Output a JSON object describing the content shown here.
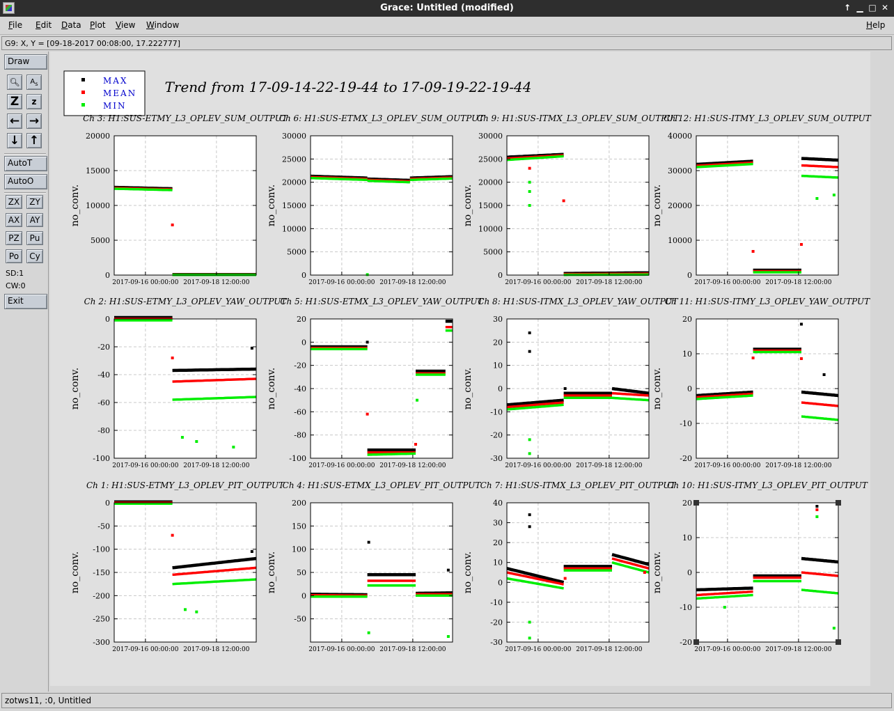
{
  "window": {
    "title": "Grace: Untitled (modified)"
  },
  "menubar": {
    "items": [
      {
        "label": "File",
        "u": "F",
        "rest": "ile"
      },
      {
        "label": "Edit",
        "u": "E",
        "rest": "dit"
      },
      {
        "label": "Data",
        "u": "D",
        "rest": "ata"
      },
      {
        "label": "Plot",
        "u": "P",
        "rest": "lot"
      },
      {
        "label": "View",
        "u": "V",
        "rest": "iew"
      },
      {
        "label": "Window",
        "u": "W",
        "rest": "indow"
      }
    ],
    "help": {
      "label": "Help",
      "u": "H",
      "rest": "elp"
    }
  },
  "locator": "G9: X, Y = [09-18-2017 00:08:00, 17.222777]",
  "toolbar": {
    "draw": "Draw",
    "autoT": "AutoT",
    "autoO": "AutoO",
    "zx": "ZX",
    "zy": "ZY",
    "ax": "AX",
    "ay": "AY",
    "pz": "PZ",
    "pu": "Pu",
    "po": "Po",
    "cy": "Cy",
    "sd": "SD:1",
    "cw": "CW:0",
    "exit": "Exit"
  },
  "status": "zotws11, :0, Untitled",
  "graph_title": "Trend from 17-09-14-22-19-44 to 17-09-19-22-19-44",
  "legend": [
    {
      "label": "MAX",
      "color": "#000000"
    },
    {
      "label": "MEAN",
      "color": "#ff0000"
    },
    {
      "label": "MIN",
      "color": "#00ee00"
    }
  ],
  "colors": {
    "max": "#000000",
    "mean": "#ff0000",
    "min": "#00ee00",
    "legend_text": "#0000cc"
  },
  "chart_data": [
    {
      "type": "scatter",
      "title": "Ch 3: H1:SUS-ETMY_L3_OPLEV_SUM_OUTPUT",
      "ylabel": "no_conv.",
      "xlabel": "",
      "x_ticks": [
        "2017-09-16 00:00:00",
        "2017-09-18 12:00:00"
      ],
      "ylim": [
        0,
        20000
      ],
      "yticks": [
        0,
        5000,
        10000,
        15000,
        20000
      ],
      "segments": [
        {
          "x": [
            0.0,
            0.41
          ],
          "max": [
            12600,
            12400
          ],
          "mean": [
            12500,
            12300
          ],
          "min": [
            12400,
            12200
          ]
        },
        {
          "x": [
            0.41,
            1.0
          ],
          "max": [
            80,
            80
          ],
          "mean": [
            50,
            50
          ],
          "min": [
            20,
            20
          ]
        }
      ],
      "outliers": [
        {
          "x": 0.41,
          "y": 7200,
          "s": "mean"
        }
      ]
    },
    {
      "type": "scatter",
      "title": "Ch 6: H1:SUS-ETMX_L3_OPLEV_SUM_OUTPUT",
      "ylabel": "no_conv.",
      "xlabel": "",
      "x_ticks": [
        "2017-09-16 00:00:00",
        "2017-09-18 12:00:00"
      ],
      "ylim": [
        0,
        30000
      ],
      "yticks": [
        0,
        5000,
        10000,
        15000,
        20000,
        25000,
        30000
      ],
      "segments": [
        {
          "x": [
            0.0,
            0.4
          ],
          "max": [
            21300,
            20900
          ],
          "mean": [
            21100,
            20700
          ],
          "min": [
            20900,
            20500
          ]
        },
        {
          "x": [
            0.4,
            0.7
          ],
          "max": [
            20700,
            20400
          ],
          "mean": [
            20500,
            20200
          ],
          "min": [
            20300,
            20000
          ]
        },
        {
          "x": [
            0.7,
            1.0
          ],
          "max": [
            20900,
            21200
          ],
          "mean": [
            20700,
            21000
          ],
          "min": [
            20500,
            20800
          ]
        }
      ],
      "outliers": [
        {
          "x": 0.4,
          "y": 100,
          "s": "min"
        }
      ]
    },
    {
      "type": "scatter",
      "title": "Ch 9: H1:SUS-ITMX_L3_OPLEV_SUM_OUTPUT",
      "ylabel": "no_conv.",
      "xlabel": "",
      "x_ticks": [
        "2017-09-16 00:00:00",
        "2017-09-18 12:00:00"
      ],
      "ylim": [
        0,
        30000
      ],
      "yticks": [
        0,
        5000,
        10000,
        15000,
        20000,
        25000,
        30000
      ],
      "segments": [
        {
          "x": [
            0.0,
            0.4
          ],
          "max": [
            25400,
            26000
          ],
          "mean": [
            25100,
            25800
          ],
          "min": [
            24800,
            25600
          ]
        },
        {
          "x": [
            0.4,
            1.0
          ],
          "max": [
            350,
            500
          ],
          "mean": [
            200,
            300
          ],
          "min": [
            50,
            100
          ]
        }
      ],
      "outliers": [
        {
          "x": 0.16,
          "y": 15000,
          "s": "min"
        },
        {
          "x": 0.16,
          "y": 20000,
          "s": "min"
        },
        {
          "x": 0.16,
          "y": 18000,
          "s": "min"
        },
        {
          "x": 0.16,
          "y": 23000,
          "s": "mean"
        },
        {
          "x": 0.4,
          "y": 16000,
          "s": "mean"
        }
      ]
    },
    {
      "type": "scatter",
      "title": "Ch 12: H1:SUS-ITMY_L3_OPLEV_SUM_OUTPUT",
      "ylabel": "no_conv.",
      "xlabel": "",
      "x_ticks": [
        "2017-09-16 00:00:00",
        "2017-09-18 12:00:00"
      ],
      "ylim": [
        0,
        40000
      ],
      "yticks": [
        0,
        10000,
        20000,
        30000,
        40000
      ],
      "segments": [
        {
          "x": [
            0.0,
            0.4
          ],
          "max": [
            31800,
            32700
          ],
          "mean": [
            31400,
            32300
          ],
          "min": [
            31000,
            31900
          ]
        },
        {
          "x": [
            0.4,
            0.74
          ],
          "max": [
            1400,
            1400
          ],
          "mean": [
            1100,
            1100
          ],
          "min": [
            800,
            800
          ]
        },
        {
          "x": [
            0.74,
            1.0
          ],
          "max": [
            33500,
            33000
          ],
          "mean": [
            31500,
            31000
          ],
          "min": [
            28500,
            28000
          ]
        }
      ],
      "outliers": [
        {
          "x": 0.4,
          "y": 6800,
          "s": "mean"
        },
        {
          "x": 0.74,
          "y": 8800,
          "s": "mean"
        },
        {
          "x": 0.85,
          "y": 22000,
          "s": "min"
        },
        {
          "x": 0.97,
          "y": 23000,
          "s": "min"
        }
      ]
    },
    {
      "type": "scatter",
      "title": "Ch 2: H1:SUS-ETMY_L3_OPLEV_YAW_OUTPUT",
      "ylabel": "no_conv.",
      "xlabel": "",
      "x_ticks": [
        "2017-09-16 00:00:00",
        "2017-09-18 12:00:00"
      ],
      "ylim": [
        -100,
        0
      ],
      "yticks": [
        -100,
        -80,
        -60,
        -40,
        -20,
        0
      ],
      "segments": [
        {
          "x": [
            0.0,
            0.41
          ],
          "max": [
            1,
            1
          ],
          "mean": [
            0,
            0
          ],
          "min": [
            -1,
            -1
          ]
        },
        {
          "x": [
            0.41,
            1.0
          ],
          "max": [
            -37,
            -36
          ],
          "mean": [
            -45,
            -43
          ],
          "min": [
            -58,
            -56
          ]
        }
      ],
      "outliers": [
        {
          "x": 0.41,
          "y": -28,
          "s": "mean"
        },
        {
          "x": 0.48,
          "y": -85,
          "s": "min"
        },
        {
          "x": 0.58,
          "y": -88,
          "s": "min"
        },
        {
          "x": 0.84,
          "y": -92,
          "s": "min"
        },
        {
          "x": 0.97,
          "y": -21,
          "s": "max"
        }
      ]
    },
    {
      "type": "scatter",
      "title": "Ch 5: H1:SUS-ETMX_L3_OPLEV_YAW_OUTPUT",
      "ylabel": "no_conv.",
      "xlabel": "",
      "x_ticks": [
        "2017-09-16 00:00:00",
        "2017-09-18 12:00:00"
      ],
      "ylim": [
        -100,
        20
      ],
      "yticks": [
        -100,
        -80,
        -60,
        -40,
        -20,
        0,
        20
      ],
      "segments": [
        {
          "x": [
            0.0,
            0.4
          ],
          "max": [
            -4,
            -4
          ],
          "mean": [
            -5,
            -5
          ],
          "min": [
            -6,
            -6
          ]
        },
        {
          "x": [
            0.4,
            0.74
          ],
          "max": [
            -93,
            -93
          ],
          "mean": [
            -95,
            -95
          ],
          "min": [
            -97,
            -96
          ]
        },
        {
          "x": [
            0.74,
            0.95
          ],
          "max": [
            -25,
            -25
          ],
          "mean": [
            -27,
            -27
          ],
          "min": [
            -28,
            -28
          ]
        },
        {
          "x": [
            0.95,
            1.0
          ],
          "max": [
            18,
            18
          ],
          "mean": [
            13,
            13
          ],
          "min": [
            10,
            10
          ]
        }
      ],
      "outliers": [
        {
          "x": 0.4,
          "y": 0,
          "s": "max"
        },
        {
          "x": 0.4,
          "y": -62,
          "s": "mean"
        },
        {
          "x": 0.74,
          "y": -88,
          "s": "mean"
        },
        {
          "x": 0.75,
          "y": -50,
          "s": "min"
        }
      ]
    },
    {
      "type": "scatter",
      "title": "Ch 8: H1:SUS-ITMX_L3_OPLEV_YAW_OUTPUT",
      "ylabel": "no_conv.",
      "xlabel": "",
      "x_ticks": [
        "2017-09-16 00:00:00",
        "2017-09-18 12:00:00"
      ],
      "ylim": [
        -30,
        30
      ],
      "yticks": [
        -30,
        -20,
        -10,
        0,
        10,
        20,
        30
      ],
      "segments": [
        {
          "x": [
            0.0,
            0.4
          ],
          "max": [
            -7,
            -5
          ],
          "mean": [
            -8,
            -6
          ],
          "min": [
            -9,
            -7
          ]
        },
        {
          "x": [
            0.4,
            0.74
          ],
          "max": [
            -2,
            -2
          ],
          "mean": [
            -3,
            -3
          ],
          "min": [
            -4,
            -4
          ]
        },
        {
          "x": [
            0.74,
            1.0
          ],
          "max": [
            0,
            -2
          ],
          "mean": [
            -2,
            -3
          ],
          "min": [
            -4,
            -5
          ]
        }
      ],
      "outliers": [
        {
          "x": 0.16,
          "y": 24,
          "s": "max"
        },
        {
          "x": 0.16,
          "y": 16,
          "s": "max"
        },
        {
          "x": 0.16,
          "y": -28,
          "s": "min"
        },
        {
          "x": 0.16,
          "y": -22,
          "s": "min"
        },
        {
          "x": 0.41,
          "y": 0,
          "s": "max"
        }
      ]
    },
    {
      "type": "scatter",
      "title": "Ch 11: H1:SUS-ITMY_L3_OPLEV_YAW_OUTPUT",
      "ylabel": "no_conv.",
      "xlabel": "",
      "x_ticks": [
        "2017-09-16 00:00:00",
        "2017-09-18 12:00:00"
      ],
      "ylim": [
        -20,
        20
      ],
      "yticks": [
        -20,
        -10,
        0,
        10,
        20
      ],
      "segments": [
        {
          "x": [
            0.0,
            0.4
          ],
          "max": [
            -2,
            -1
          ],
          "mean": [
            -2.5,
            -1.5
          ],
          "min": [
            -3,
            -2
          ]
        },
        {
          "x": [
            0.4,
            0.74
          ],
          "max": [
            11.3,
            11.3
          ],
          "mean": [
            10.9,
            10.9
          ],
          "min": [
            10.5,
            10.5
          ]
        },
        {
          "x": [
            0.74,
            1.0
          ],
          "max": [
            -1,
            -2
          ],
          "mean": [
            -4,
            -5
          ],
          "min": [
            -8,
            -9
          ]
        }
      ],
      "outliers": [
        {
          "x": 0.4,
          "y": 8.8,
          "s": "mean"
        },
        {
          "x": 0.74,
          "y": 8.6,
          "s": "mean"
        },
        {
          "x": 0.74,
          "y": 18.5,
          "s": "max"
        },
        {
          "x": 0.9,
          "y": 4,
          "s": "max"
        }
      ]
    },
    {
      "type": "scatter",
      "title": "Ch 1: H1:SUS-ETMY_L3_OPLEV_PIT_OUTPUT",
      "ylabel": "no_conv.",
      "xlabel": "",
      "x_ticks": [
        "2017-09-16 00:00:00",
        "2017-09-18 12:00:00"
      ],
      "ylim": [
        -300,
        0
      ],
      "yticks": [
        -300,
        -250,
        -200,
        -150,
        -100,
        -50,
        0
      ],
      "segments": [
        {
          "x": [
            0.0,
            0.41
          ],
          "max": [
            2,
            2
          ],
          "mean": [
            0,
            0
          ],
          "min": [
            -2,
            -2
          ]
        },
        {
          "x": [
            0.41,
            1.0
          ],
          "max": [
            -140,
            -120
          ],
          "mean": [
            -155,
            -140
          ],
          "min": [
            -175,
            -165
          ]
        }
      ],
      "outliers": [
        {
          "x": 0.41,
          "y": -70,
          "s": "mean"
        },
        {
          "x": 0.5,
          "y": -230,
          "s": "min"
        },
        {
          "x": 0.58,
          "y": -235,
          "s": "min"
        },
        {
          "x": 0.97,
          "y": -105,
          "s": "max"
        }
      ]
    },
    {
      "type": "scatter",
      "title": "Ch 4: H1:SUS-ETMX_L3_OPLEV_PIT_OUTPUT",
      "ylabel": "no_conv.",
      "xlabel": "",
      "x_ticks": [
        "2017-09-16 00:00:00",
        "2017-09-18 12:00:00"
      ],
      "ylim": [
        -100,
        200
      ],
      "yticks": [
        -50,
        0,
        50,
        100,
        150,
        200
      ],
      "segments": [
        {
          "x": [
            0.0,
            0.4
          ],
          "max": [
            3,
            2
          ],
          "mean": [
            1,
            0
          ],
          "min": [
            -2,
            -2
          ]
        },
        {
          "x": [
            0.4,
            0.74
          ],
          "max": [
            45,
            45
          ],
          "mean": [
            32,
            32
          ],
          "min": [
            22,
            22
          ]
        },
        {
          "x": [
            0.74,
            1.0
          ],
          "max": [
            5,
            6
          ],
          "mean": [
            3,
            3
          ],
          "min": [
            0,
            0
          ]
        }
      ],
      "outliers": [
        {
          "x": 0.41,
          "y": 115,
          "s": "max"
        },
        {
          "x": 0.41,
          "y": -80,
          "s": "min"
        },
        {
          "x": 0.97,
          "y": 55,
          "s": "max"
        },
        {
          "x": 0.97,
          "y": -88,
          "s": "min"
        }
      ]
    },
    {
      "type": "scatter",
      "title": "Ch 7: H1:SUS-ITMX_L3_OPLEV_PIT_OUTPUT",
      "ylabel": "no_conv.",
      "xlabel": "",
      "x_ticks": [
        "2017-09-16 00:00:00",
        "2017-09-18 12:00:00"
      ],
      "ylim": [
        -30,
        40
      ],
      "yticks": [
        -30,
        -20,
        -10,
        0,
        10,
        20,
        30,
        40
      ],
      "segments": [
        {
          "x": [
            0.0,
            0.4
          ],
          "max": [
            7,
            0
          ],
          "mean": [
            5,
            -1
          ],
          "min": [
            2,
            -3
          ]
        },
        {
          "x": [
            0.4,
            0.74
          ],
          "max": [
            8,
            8
          ],
          "mean": [
            7,
            7
          ],
          "min": [
            6,
            6
          ]
        },
        {
          "x": [
            0.74,
            1.0
          ],
          "max": [
            14,
            9
          ],
          "mean": [
            12,
            7
          ],
          "min": [
            10,
            5
          ]
        }
      ],
      "outliers": [
        {
          "x": 0.16,
          "y": 34,
          "s": "max"
        },
        {
          "x": 0.16,
          "y": 28,
          "s": "max"
        },
        {
          "x": 0.16,
          "y": -28,
          "s": "min"
        },
        {
          "x": 0.16,
          "y": -20,
          "s": "min"
        },
        {
          "x": 0.41,
          "y": 2,
          "s": "mean"
        },
        {
          "x": 0.97,
          "y": 5,
          "s": "mean"
        }
      ]
    },
    {
      "type": "scatter",
      "title": "Ch 10: H1:SUS-ITMY_L3_OPLEV_PIT_OUTPUT",
      "ylabel": "no_conv.",
      "xlabel": "",
      "x_ticks": [
        "2017-09-16 00:00:00",
        "2017-09-18 12:00:00"
      ],
      "ylim": [
        -20,
        20
      ],
      "yticks": [
        -20,
        -10,
        0,
        10,
        20
      ],
      "segments": [
        {
          "x": [
            0.0,
            0.4
          ],
          "max": [
            -5,
            -4.5
          ],
          "mean": [
            -6.5,
            -5.5
          ],
          "min": [
            -7.5,
            -6.5
          ]
        },
        {
          "x": [
            0.4,
            0.74
          ],
          "max": [
            -1,
            -1
          ],
          "mean": [
            -1.5,
            -1.5
          ],
          "min": [
            -2.5,
            -2.5
          ]
        },
        {
          "x": [
            0.74,
            1.0
          ],
          "max": [
            4,
            3
          ],
          "mean": [
            0,
            -1
          ],
          "min": [
            -5,
            -6
          ]
        }
      ],
      "outliers": [
        {
          "x": 0.85,
          "y": 19,
          "s": "max"
        },
        {
          "x": 0.85,
          "y": 18,
          "s": "mean"
        },
        {
          "x": 0.85,
          "y": 16,
          "s": "min"
        },
        {
          "x": 0.97,
          "y": -16,
          "s": "min"
        },
        {
          "x": 0.2,
          "y": -10,
          "s": "min"
        }
      ]
    }
  ]
}
